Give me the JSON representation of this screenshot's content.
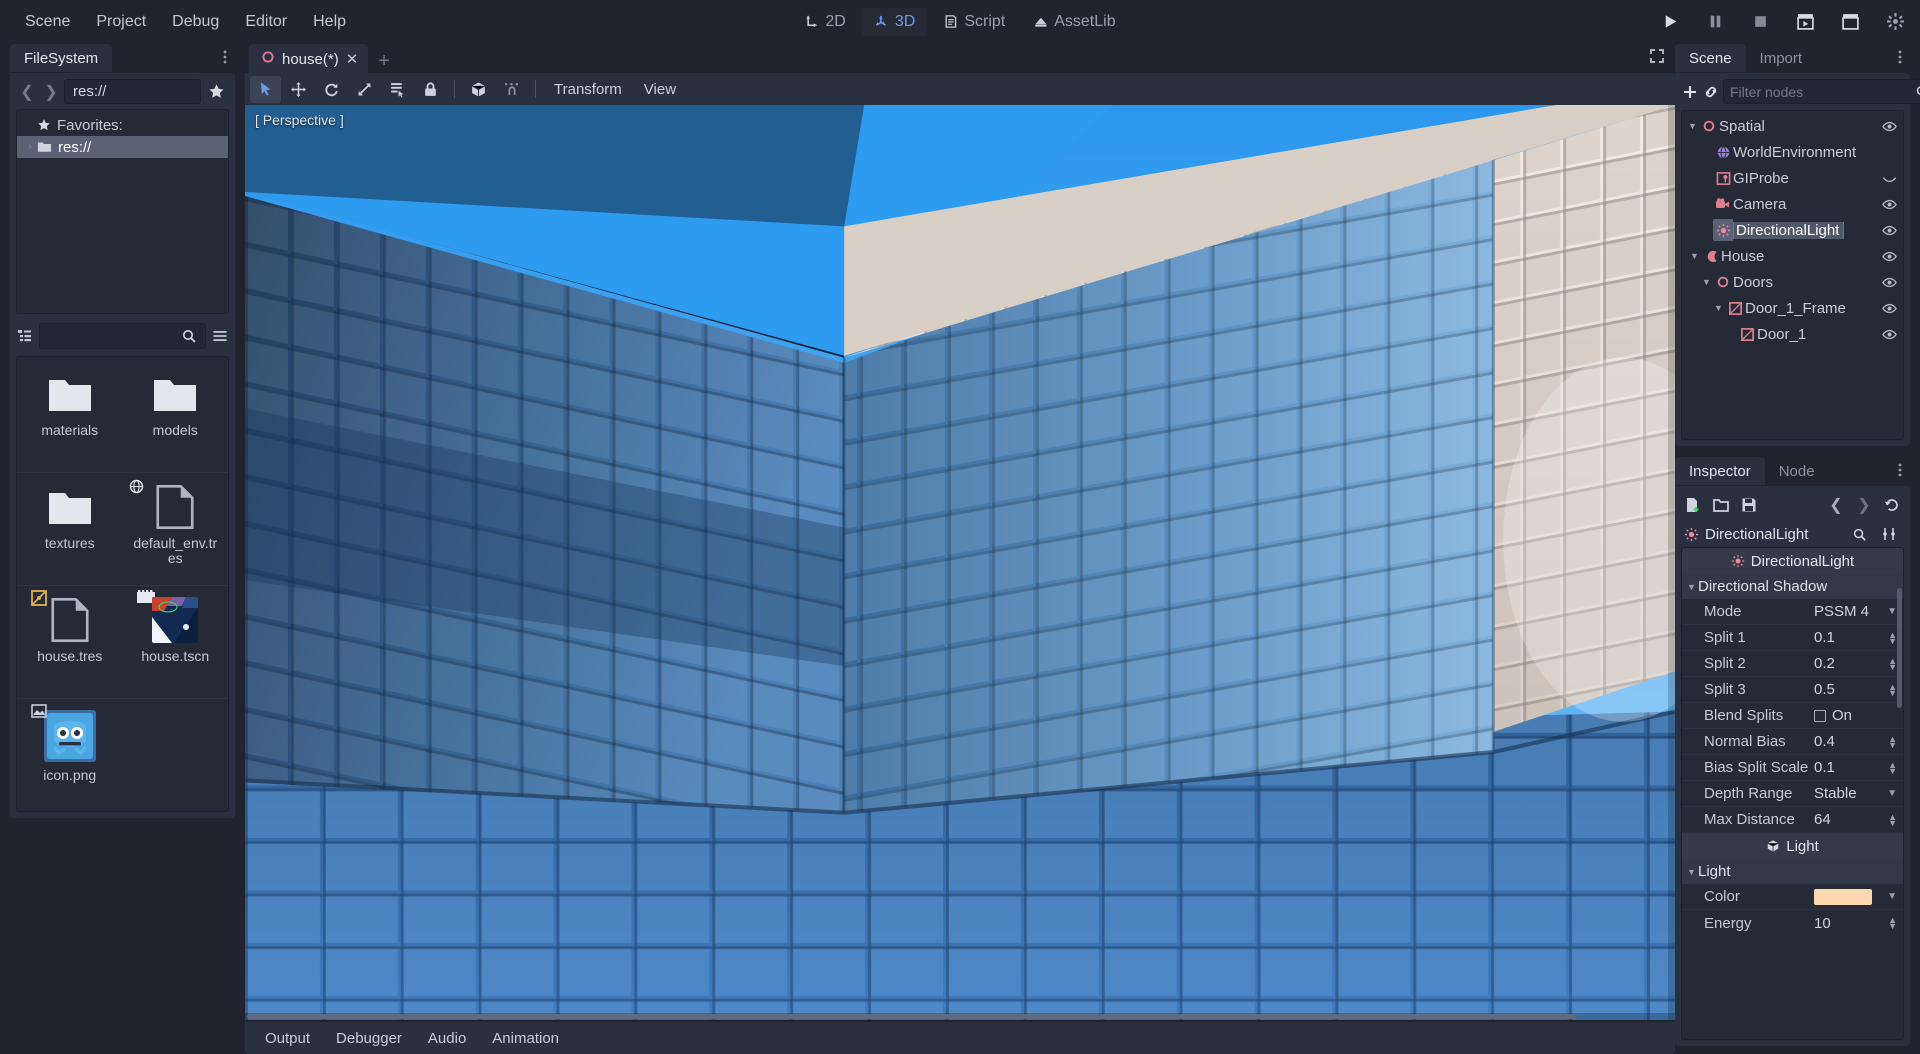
{
  "app": {
    "menu": [
      "Scene",
      "Project",
      "Debug",
      "Editor",
      "Help"
    ],
    "center_tabs": [
      {
        "label": "2D",
        "icon": "2d-axis-icon",
        "active": false
      },
      {
        "label": "3D",
        "icon": "3d-axis-icon",
        "active": true
      },
      {
        "label": "Script",
        "icon": "script-icon",
        "active": false
      },
      {
        "label": "AssetLib",
        "icon": "assetlib-icon",
        "active": false
      }
    ],
    "play_buttons": [
      {
        "name": "play-project-button",
        "icon": "play-icon"
      },
      {
        "name": "pause-scene-button",
        "icon": "pause-icon"
      },
      {
        "name": "stop-button",
        "icon": "stop-icon"
      },
      {
        "name": "play-scene-button",
        "icon": "play-scene-icon"
      },
      {
        "name": "play-custom-scene-button",
        "icon": "play-custom-icon"
      },
      {
        "name": "editor-settings-button",
        "icon": "gear-spinner-icon"
      }
    ]
  },
  "filesystem": {
    "tab_label": "FileSystem",
    "path_value": "res://",
    "favorites_label": "Favorites:",
    "tree": [
      {
        "label": "Favorites:",
        "icon": "star-icon",
        "indent": 0,
        "selected": false,
        "expander": ""
      },
      {
        "label": "res://",
        "icon": "folder-icon",
        "indent": 0,
        "selected": true,
        "expander": "›"
      }
    ],
    "search_placeholder": "",
    "files": [
      {
        "name": "materials",
        "type": "folder",
        "badge": "",
        "overlay": ""
      },
      {
        "name": "models",
        "type": "folder",
        "badge": "",
        "overlay": ""
      },
      {
        "name": "textures",
        "type": "folder",
        "badge": "",
        "overlay": ""
      },
      {
        "name": "default_env.tres",
        "type": "resource",
        "badge": "",
        "overlay": "globe-icon"
      },
      {
        "name": "house.tres",
        "type": "resource",
        "badge": "mesh-badge-icon",
        "overlay": ""
      },
      {
        "name": "house.tscn",
        "type": "scene-thumbnail",
        "badge": "scene-badge-icon",
        "overlay": ""
      },
      {
        "name": "icon.png",
        "type": "image-thumbnail",
        "badge": "image-badge-icon",
        "overlay": "",
        "selected": true
      }
    ]
  },
  "editor": {
    "scene_tab": {
      "label": "house(*)",
      "icon": "spatial-node-icon",
      "close": "✕"
    },
    "new_tab_label": "+",
    "viewport_toolbar": {
      "tools": [
        {
          "name": "select-mode-tool",
          "icon": "cursor-icon",
          "active": true
        },
        {
          "name": "move-mode-tool",
          "icon": "move-icon",
          "active": false
        },
        {
          "name": "rotate-mode-tool",
          "icon": "rotate-icon",
          "active": false
        },
        {
          "name": "scale-mode-tool",
          "icon": "scale-icon",
          "active": false
        },
        {
          "name": "list-select-tool",
          "icon": "list-select-icon",
          "active": false
        },
        {
          "name": "lock-tool",
          "icon": "lock-icon",
          "active": false
        },
        {
          "name": "mesh-options-tool",
          "icon": "mesh-icon",
          "active": false
        },
        {
          "name": "snap-tool",
          "icon": "snap-icon",
          "active": false
        }
      ],
      "menus": [
        "Transform",
        "View"
      ]
    },
    "viewport": {
      "perspective_label": "[ Perspective ]"
    },
    "bottom_tabs": [
      "Output",
      "Debugger",
      "Audio",
      "Animation"
    ]
  },
  "scene_dock": {
    "tabs": [
      {
        "label": "Scene",
        "active": true
      },
      {
        "label": "Import",
        "active": false
      }
    ],
    "filter_placeholder": "Filter nodes",
    "nodes": [
      {
        "label": "Spatial",
        "indent": 0,
        "expander": "v",
        "icon": "spatial-icon",
        "color": "#e07f8f",
        "visibility": "eye-icon",
        "selected": false
      },
      {
        "label": "WorldEnvironment",
        "indent": 1,
        "expander": "",
        "icon": "world-env-icon",
        "color": "#a88fe0",
        "visibility": "",
        "selected": false
      },
      {
        "label": "GIProbe",
        "indent": 1,
        "expander": "",
        "icon": "giprobe-icon",
        "color": "#e07f8f",
        "visibility": "eye-closed-icon",
        "selected": false
      },
      {
        "label": "Camera",
        "indent": 1,
        "expander": "",
        "icon": "camera-icon",
        "color": "#e07f8f",
        "visibility": "eye-icon",
        "selected": false
      },
      {
        "label": "DirectionalLight",
        "indent": 1,
        "expander": "",
        "icon": "directional-light-icon",
        "color": "#e88a9c",
        "visibility": "eye-icon",
        "selected": true
      },
      {
        "label": "House",
        "indent": 0,
        "expander": "v",
        "icon": "house-node-icon",
        "color": "#e07f8f",
        "visibility": "eye-icon",
        "selected": false
      },
      {
        "label": "Doors",
        "indent": 1,
        "expander": "v",
        "icon": "spatial-icon",
        "color": "#e07f8f",
        "visibility": "eye-icon",
        "selected": false
      },
      {
        "label": "Door_1_Frame",
        "indent": 2,
        "expander": "v",
        "icon": "mesh-instance-icon",
        "color": "#e07f8f",
        "visibility": "eye-icon",
        "selected": false
      },
      {
        "label": "Door_1",
        "indent": 3,
        "expander": "",
        "icon": "mesh-instance-icon",
        "color": "#e07f8f",
        "visibility": "eye-icon",
        "selected": false
      }
    ]
  },
  "inspector": {
    "tabs": [
      {
        "label": "Inspector",
        "active": true
      },
      {
        "label": "Node",
        "active": false
      }
    ],
    "object_name": "DirectionalLight",
    "header_label": "DirectionalLight",
    "sections": [
      {
        "title": "Directional Shadow",
        "properties": [
          {
            "name": "Mode",
            "value": "PSSM 4",
            "control": "dropdown"
          },
          {
            "name": "Split 1",
            "value": "0.1",
            "control": "spin"
          },
          {
            "name": "Split 2",
            "value": "0.2",
            "control": "spin"
          },
          {
            "name": "Split 3",
            "value": "0.5",
            "control": "spin"
          },
          {
            "name": "Blend Splits",
            "value": "On",
            "control": "checkbox"
          },
          {
            "name": "Normal Bias",
            "value": "0.4",
            "control": "spin"
          },
          {
            "name": "Bias Split Scale",
            "value": "0.1",
            "control": "spin"
          },
          {
            "name": "Depth Range",
            "value": "Stable",
            "control": "dropdown"
          },
          {
            "name": "Max Distance",
            "value": "64",
            "control": "spin"
          }
        ]
      }
    ],
    "light_header": "Light",
    "light_section_title": "Light",
    "light_properties": [
      {
        "name": "Color",
        "value": "",
        "control": "color",
        "color": "#fbd8b0"
      },
      {
        "name": "Energy",
        "value": "10",
        "control": "spin"
      }
    ]
  },
  "colors": {
    "accent": "#6d9bf0",
    "panel": "#2b3040",
    "background": "#21242e",
    "light_color": "#fbd8b0"
  }
}
